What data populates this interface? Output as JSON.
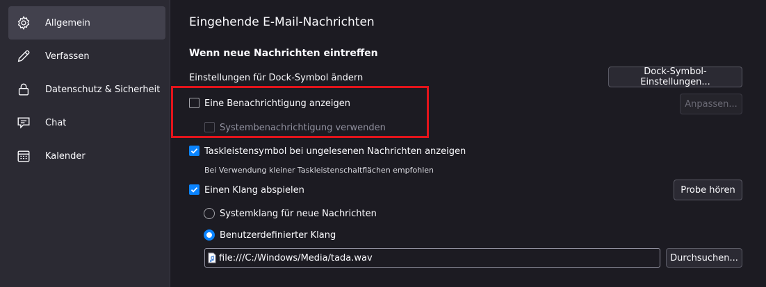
{
  "sidebar": {
    "items": [
      {
        "label": "Allgemein",
        "icon": "gear-icon",
        "active": true
      },
      {
        "label": "Verfassen",
        "icon": "pencil-icon",
        "active": false
      },
      {
        "label": "Datenschutz & Sicherheit",
        "icon": "lock-icon",
        "active": false
      },
      {
        "label": "Chat",
        "icon": "chat-icon",
        "active": false
      },
      {
        "label": "Kalender",
        "icon": "calendar-icon",
        "active": false
      }
    ]
  },
  "main": {
    "section_title": "Eingehende E-Mail-Nachrichten",
    "subsection_title": "Wenn neue Nachrichten eintreffen",
    "dock_label": "Einstellungen für Dock-Symbol ändern",
    "dock_button": "Dock-Symbol-Einstellungen...",
    "show_notification": {
      "label": "Eine Benachrichtigung anzeigen",
      "checked": false
    },
    "customize_button": "Anpassen...",
    "system_notification": {
      "label": "Systembenachrichtigung verwenden",
      "checked": false,
      "disabled": true
    },
    "taskbar_icon": {
      "label": "Taskleistensymbol bei ungelesenen Nachrichten anzeigen",
      "checked": true
    },
    "taskbar_hint": "Bei Verwendung kleiner Taskleistenschaltflächen empfohlen",
    "play_sound": {
      "label": "Einen Klang abspielen",
      "checked": true
    },
    "preview_button": "Probe hören",
    "sound_system": {
      "label": "Systemklang für neue Nachrichten",
      "selected": false
    },
    "sound_custom": {
      "label": "Benutzerdefinierter Klang",
      "selected": true
    },
    "sound_file": "file:///C:/Windows/Media/tada.wav",
    "browse_button": "Durchsuchen..."
  },
  "colors": {
    "accent": "#0a84ff",
    "highlight_box": "#e3141b",
    "background": "#1c1b22",
    "sidebar": "#2b2a33"
  }
}
